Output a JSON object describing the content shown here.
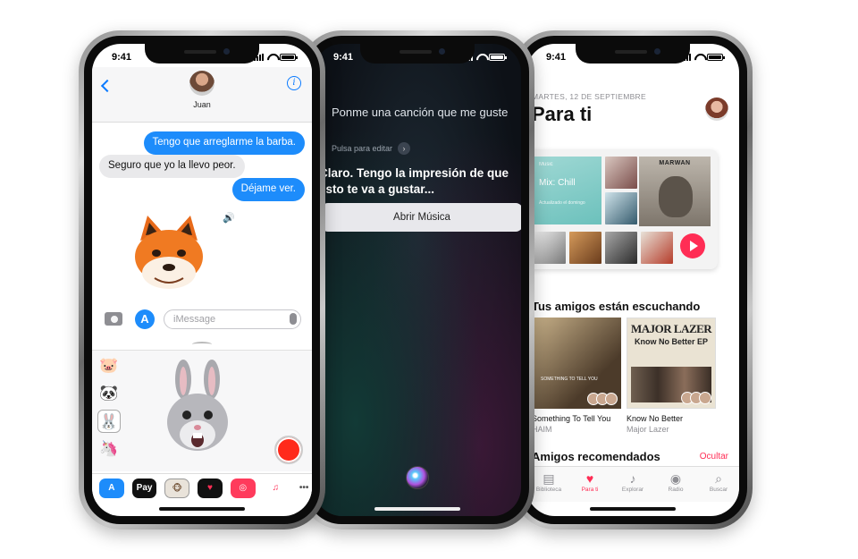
{
  "messages_phone": {
    "status_time": "9:41",
    "contact_name": "Juan",
    "info_label": "i",
    "bubbles": [
      {
        "text": "Tengo que arreglarme la barba.",
        "side": "out"
      },
      {
        "text": "Seguro que yo la llevo peor.",
        "side": "in"
      },
      {
        "text": "Déjame ver.",
        "side": "out"
      }
    ],
    "input_placeholder": "iMessage",
    "app_store_glyph": "A",
    "app_strip": [
      {
        "label": "A",
        "icon": "app-store-icon"
      },
      {
        "label": "Pay",
        "icon": "apple-pay-icon"
      },
      {
        "label": "🐵",
        "icon": "animoji-icon"
      },
      {
        "label": "♥",
        "icon": "digital-touch-icon"
      },
      {
        "label": "◎",
        "icon": "image-search-icon"
      },
      {
        "label": "♫",
        "icon": "music-icon"
      },
      {
        "label": "•••",
        "icon": "more-icon"
      }
    ],
    "colors": {
      "bubble_out": "#1d8cfb",
      "bubble_in": "#e9e9eb",
      "record": "#ff2a1b"
    }
  },
  "siri_phone": {
    "status_time": "9:41",
    "query": "Ponme una canción que me guste",
    "edit_hint": "Pulsa para editar",
    "answer": "Claro. Tengo la impresión de que esto te va a gustar...",
    "button_label": "Abrir Música"
  },
  "music_phone": {
    "status_time": "9:41",
    "date": "MARTES, 12 DE SEPTIEMBRE",
    "title": "Para ti",
    "mix": {
      "brand": " Music",
      "name": "Mix: Chill",
      "updated": "Actualizado el domingo"
    },
    "featured_album_artist": "MARWAN",
    "friends_section_title": "Tus amigos están escuchando",
    "albums": [
      {
        "title": "Something To Tell You",
        "artist": "HAIM",
        "cover_text": "SOMETHING TO TELL YOU"
      },
      {
        "title": "Know No Better",
        "artist": "Major Lazer",
        "cover_brand": "MAJOR LAZER",
        "cover_title": "Know No Better EP"
      }
    ],
    "recommended_title": "Amigos recomendados",
    "hide_label": "Ocultar",
    "tabs": [
      {
        "label": "Biblioteca",
        "icon": "library-icon",
        "glyph": "▤",
        "active": false
      },
      {
        "label": "Para ti",
        "icon": "heart-icon",
        "glyph": "♥",
        "active": true
      },
      {
        "label": "Explorar",
        "icon": "music-note-icon",
        "glyph": "♪",
        "active": false
      },
      {
        "label": "Radio",
        "icon": "radio-icon",
        "glyph": "◉",
        "active": false
      },
      {
        "label": "Buscar",
        "icon": "search-icon",
        "glyph": "⌕",
        "active": false
      }
    ],
    "colors": {
      "accent": "#ff2d55"
    }
  }
}
